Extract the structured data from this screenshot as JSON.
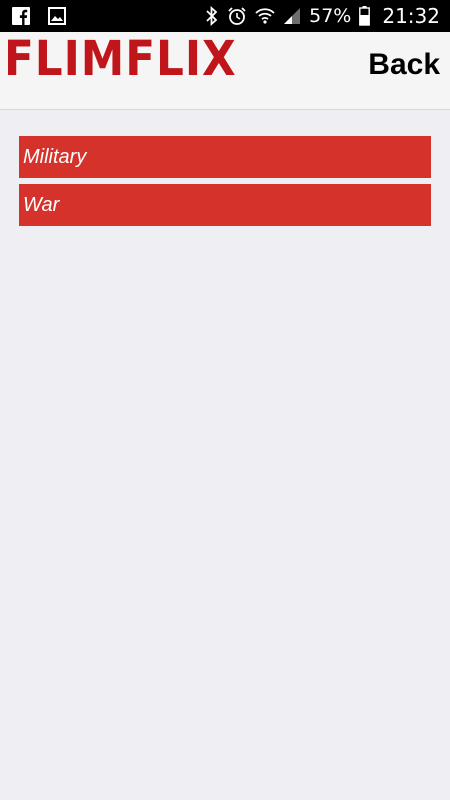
{
  "status_bar": {
    "battery_percent": "57%",
    "time": "21:32",
    "icons": [
      "facebook-icon",
      "image-icon",
      "bluetooth-icon",
      "alarm-icon",
      "wifi-icon",
      "signal-icon",
      "battery-icon"
    ]
  },
  "header": {
    "logo_text": "FLIMFLIX",
    "back_label": "Back",
    "logo_color": "#c0151b"
  },
  "genres": {
    "items": [
      {
        "label": "Military"
      },
      {
        "label": "War"
      }
    ],
    "item_color": "#d6322c"
  }
}
